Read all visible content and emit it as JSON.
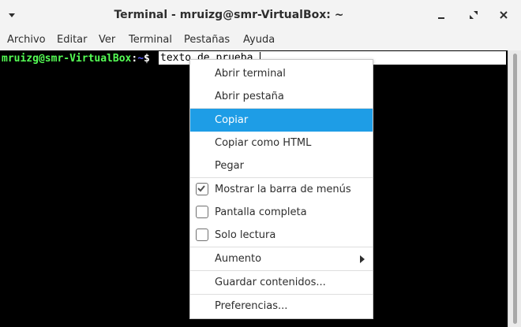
{
  "window": {
    "title": "Terminal - mruizg@smr-VirtualBox: ~"
  },
  "menubar": {
    "items": [
      {
        "label": "Archivo"
      },
      {
        "label": "Editar"
      },
      {
        "label": "Ver"
      },
      {
        "label": "Terminal"
      },
      {
        "label": "Pestañas"
      },
      {
        "label": "Ayuda"
      }
    ]
  },
  "terminal": {
    "prompt_user": "mruizg@smr-VirtualBox",
    "prompt_colon": ":",
    "prompt_path": "~",
    "prompt_dollar": "$",
    "selected_text": "texto de prueba"
  },
  "context_menu": {
    "items": [
      {
        "label": "Abrir terminal"
      },
      {
        "label": "Abrir pestaña"
      },
      {
        "label": "Copiar",
        "highlighted": true
      },
      {
        "label": "Copiar como HTML"
      },
      {
        "label": "Pegar"
      },
      {
        "label": "Mostrar la barra de menús",
        "checked": true
      },
      {
        "label": "Pantalla completa",
        "checked": false
      },
      {
        "label": "Solo lectura",
        "checked": false
      },
      {
        "label": "Aumento",
        "submenu": true
      },
      {
        "label": "Guardar contenidos..."
      },
      {
        "label": "Preferencias..."
      }
    ]
  },
  "colors": {
    "highlight": "#1e9de6",
    "prompt_user": "#55ff55",
    "prompt_path": "#5c5cff"
  }
}
